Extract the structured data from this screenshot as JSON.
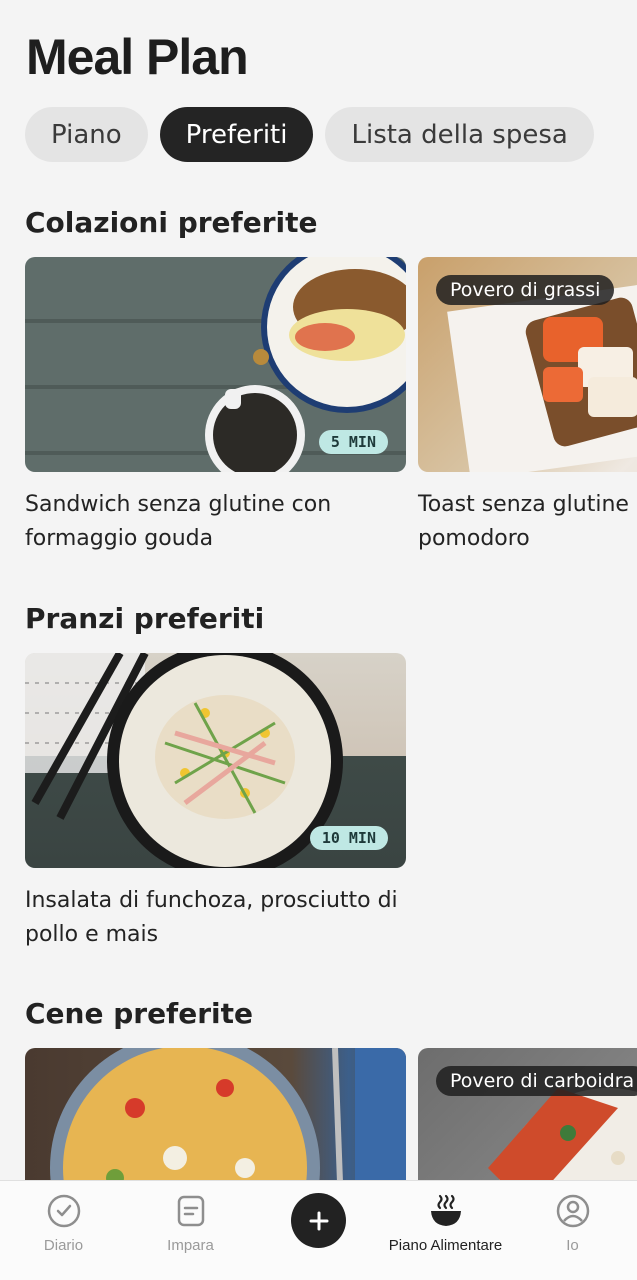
{
  "header": {
    "title": "Meal Plan"
  },
  "tabs": [
    {
      "label": "Piano",
      "active": false
    },
    {
      "label": "Preferiti",
      "active": true
    },
    {
      "label": "Lista della spesa",
      "active": false
    }
  ],
  "sections": [
    {
      "title": "Colazioni preferite",
      "cards": [
        {
          "name": "Sandwich senza glutine con formaggio gouda",
          "time": "5 MIN",
          "tag": ""
        },
        {
          "name": "Toast senza glutine pomodoro",
          "time": "",
          "tag": "Povero di grassi"
        }
      ]
    },
    {
      "title": "Pranzi preferiti",
      "cards": [
        {
          "name": "Insalata di funchoza, prosciutto di pollo e mais",
          "time": "10 MIN",
          "tag": ""
        }
      ]
    },
    {
      "title": "Cene preferite",
      "cards": [
        {
          "name": "",
          "time": "",
          "tag": ""
        },
        {
          "name": "",
          "time": "",
          "tag": "Povero di carboidra"
        }
      ]
    }
  ],
  "bottom_nav": [
    {
      "label": "Diario",
      "icon": "check-circle-icon",
      "active": false
    },
    {
      "label": "Impara",
      "icon": "document-icon",
      "active": false
    },
    {
      "label": "",
      "icon": "plus-icon",
      "active": false
    },
    {
      "label": "Piano Alimentare",
      "icon": "bowl-icon",
      "active": true
    },
    {
      "label": "Io",
      "icon": "user-circle-icon",
      "active": false
    }
  ],
  "colors": {
    "background": "#f4f4f4",
    "tab_active": "#242424",
    "tab_inactive": "#e4e4e4",
    "time_badge": "#bfe8e4",
    "text": "#1c1c1c"
  }
}
